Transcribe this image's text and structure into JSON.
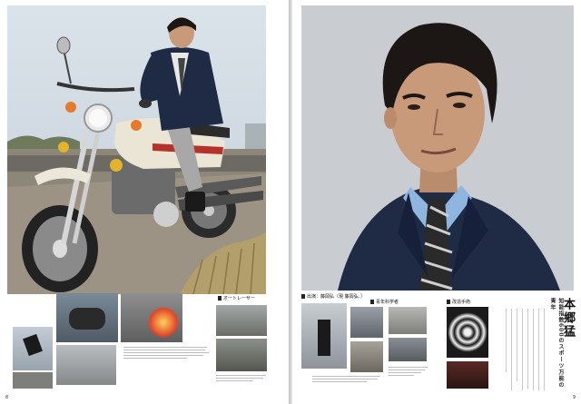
{
  "left_page": {
    "main_photo_alt": "motorcycle-rider-photo",
    "section_label": "オートレーサー",
    "page_number": "8"
  },
  "right_page": {
    "portrait_alt": "portrait-photo",
    "title": "本郷猛",
    "subtitle": "知能指数600のスポーツ万能の青年",
    "section_labels": [
      "出演：藤岡弘（現 藤岡弘、）",
      "青年科学者",
      "改造手術"
    ],
    "page_number": "9"
  },
  "colors": {
    "sky": "#c9d3dc",
    "suit": "#1f2a44",
    "bike_white": "#e8e2d2"
  }
}
